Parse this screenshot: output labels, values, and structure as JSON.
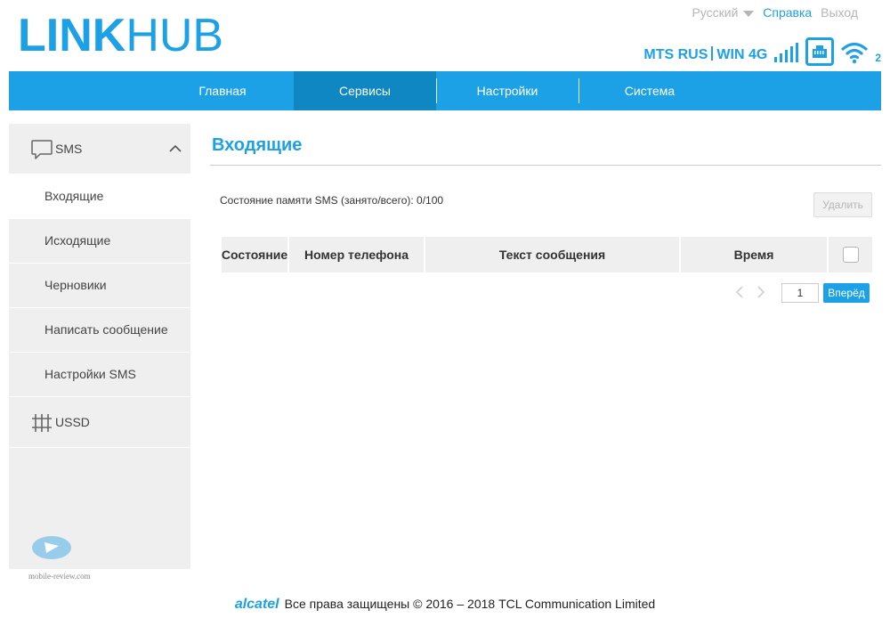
{
  "header": {
    "logo_bold": "LINK",
    "logo_light": "HUB",
    "language": "Русский",
    "help": "Справка",
    "logout": "Выход",
    "operator": "MTS RUS",
    "network": "WIN",
    "network_type": "4G",
    "wifi_clients": "2"
  },
  "nav": {
    "tabs": [
      {
        "label": "Главная"
      },
      {
        "label": "Сервисы"
      },
      {
        "label": "Настройки"
      },
      {
        "label": "Система"
      }
    ],
    "active": "Сервисы"
  },
  "sidebar": {
    "sms_group": "SMS",
    "items": [
      {
        "label": "Входящие"
      },
      {
        "label": "Исходящие"
      },
      {
        "label": "Черновики"
      },
      {
        "label": "Написать сообщение"
      },
      {
        "label": "Настройки SMS"
      }
    ],
    "ussd_group": "USSD",
    "watermark": "mobile-review.com"
  },
  "content": {
    "title": "Входящие",
    "memory_status": "Состояние памяти SMS (занято/всего): 0/100",
    "delete_button": "Удалить",
    "columns": [
      "Состояние",
      "Номер телефона",
      "Текст сообщения",
      "Время"
    ],
    "page_number": "1",
    "next_button": "Вперёд"
  },
  "footer": {
    "brand": "alcatel",
    "copyright": "Все права защищены © 2016 – 2018 TCL Communication Limited"
  },
  "colors": {
    "accent": "#1da1e6",
    "accent_dark": "#0f87c2",
    "sidebar_bg": "#efefef"
  },
  "icons": [
    "chat-bubble-icon",
    "chevron-up-icon",
    "ussd-grid-icon",
    "signal-bars-icon",
    "ethernet-icon",
    "wifi-icon",
    "chevron-left-icon",
    "chevron-right-icon"
  ]
}
